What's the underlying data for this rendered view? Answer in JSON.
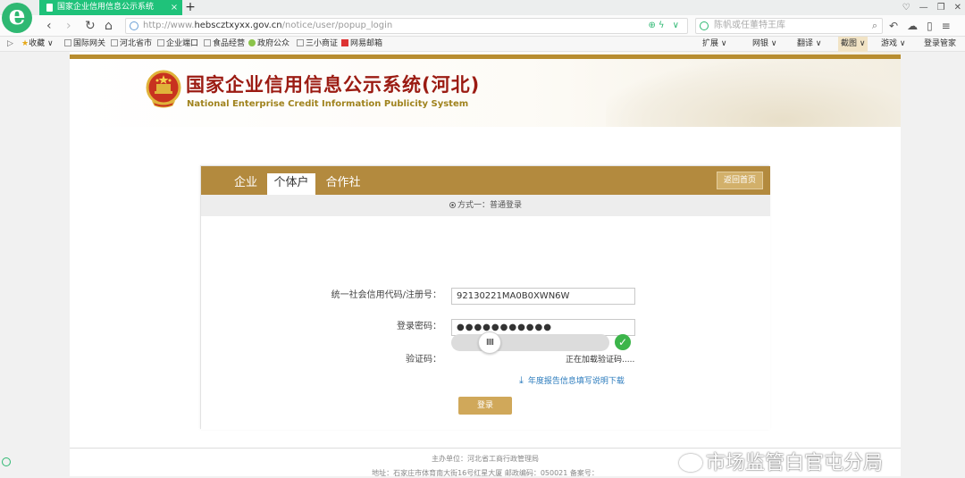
{
  "browser": {
    "tab_title": "国家企业信用信息公示系统",
    "tab_close": "×",
    "new_tab": "+",
    "window_controls": [
      "♡",
      "—",
      "❐",
      "✕"
    ],
    "nav": {
      "back": "‹",
      "forward": "›",
      "refresh": "↻",
      "home": "⌂"
    },
    "url_prefix": "http://www.",
    "url_domain": "hebscztxyxx.gov.cn",
    "url_path": "/notice/user/popup_login",
    "url_right": "⊕ϟ ∨",
    "search_placeholder": "陈帆或任董特王库",
    "search_mag": "⌕",
    "tools": [
      "↶",
      "☁",
      "▯",
      "≡"
    ],
    "bookmarks": [
      "收藏",
      "国际网关",
      "河北省市",
      "企业端口",
      "食品经营",
      "政府公众",
      "三小商证",
      "网易邮箱"
    ],
    "bookmarks_right": [
      "扩展",
      "网银",
      "翻译",
      "截图",
      "游戏",
      "登录管家"
    ]
  },
  "site": {
    "title": "国家企业信用信息公示系统(河北)",
    "subtitle": "National Enterprise Credit Information Publicity System"
  },
  "login": {
    "tabs": [
      "企业",
      "个体户",
      "合作社"
    ],
    "back_home": "返回首页",
    "method": "方式一：普通登录",
    "code_label": "统一社会信用代码/注册号：",
    "code_value": "92130221MA0B0XWN6W",
    "password_label": "登录密码：",
    "password_value": "●●●●●●●●●●●",
    "captcha_label": "验证码：",
    "slider_handle": "III",
    "check": "✓",
    "loading": "正在加载验证码.....",
    "download_icon": "⤓",
    "download_link": "年度报告信息填写说明下载",
    "login_button": "登录"
  },
  "footer": {
    "line1": "主办单位：河北省工商行政管理局",
    "line2": "地址：石家庄市体育南大街16号红星大厦 邮政编码：050021 备案号："
  },
  "watermark": "市场监管白官屯分局",
  "colors": {
    "tab_green": "#1fc27a",
    "panel_gold": "#b38a3e",
    "title_red": "#9b1b12",
    "link_blue": "#2b7bbd"
  }
}
